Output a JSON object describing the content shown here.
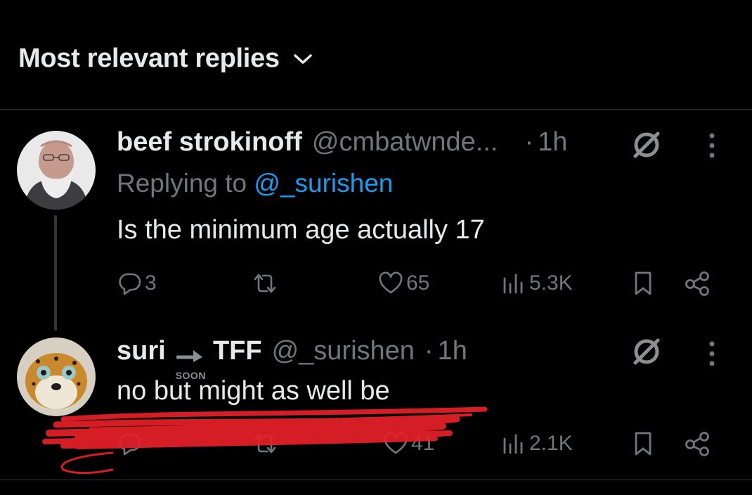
{
  "sort": {
    "label": "Most relevant replies",
    "chevron_icon": "chevron-down-icon"
  },
  "tweets": [
    {
      "name": "beef strokinoff",
      "handle": "@cmbatwnde...",
      "dot": "·",
      "time": "1h",
      "replying_prefix": "Replying to ",
      "replying_to": "@_surishen",
      "text": "Is the minimum age actually 17",
      "stats": {
        "replies": "3",
        "reposts": "",
        "likes": "65",
        "views": "5.3K"
      }
    },
    {
      "name": "suri",
      "badge_text": "SOON",
      "name_suffix": "TFF",
      "handle": "@_surishen",
      "dot": "·",
      "time": "1h",
      "text": "no but might as well be",
      "stats": {
        "replies": "",
        "reposts": "",
        "likes": "41",
        "views": "2.1K"
      }
    }
  ],
  "colors": {
    "background": "#000000",
    "text": "#e7e9ea",
    "muted": "#71767b",
    "link": "#1d9bf0",
    "divider": "#2f3336",
    "scribble": "#e8202a"
  }
}
